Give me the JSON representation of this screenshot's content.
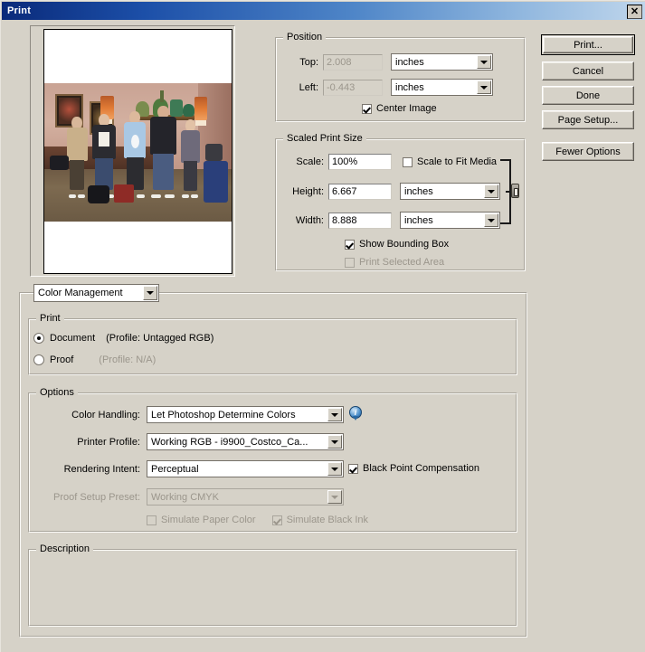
{
  "window": {
    "title": "Print",
    "close_label": "✕"
  },
  "buttons": [
    {
      "name": "print-button",
      "label": "Print...",
      "default": true
    },
    {
      "name": "cancel-button",
      "label": "Cancel",
      "default": false
    },
    {
      "name": "done-button",
      "label": "Done",
      "default": false
    },
    {
      "name": "page-setup-button",
      "label": "Page Setup...",
      "default": false
    },
    {
      "name": "fewer-options-button",
      "label": "Fewer Options",
      "default": false
    }
  ],
  "position": {
    "group_title": "Position",
    "top_label": "Top:",
    "top_value": "2.008",
    "top_units": "inches",
    "left_label": "Left:",
    "left_value": "-0.443",
    "left_units": "inches",
    "center_image_label": "Center Image",
    "center_image_checked": true
  },
  "scaled_print_size": {
    "group_title": "Scaled Print Size",
    "scale_label": "Scale:",
    "scale_value": "100%",
    "scale_to_fit_label": "Scale to Fit Media",
    "scale_to_fit_checked": false,
    "height_label": "Height:",
    "height_value": "6.667",
    "height_units": "inches",
    "width_label": "Width:",
    "width_value": "8.888",
    "width_units": "inches",
    "show_bounding_box_label": "Show Bounding Box",
    "show_bounding_box_checked": true,
    "print_selected_area_label": "Print Selected Area",
    "print_selected_area_checked": false,
    "print_selected_area_enabled": false,
    "link_icon": "chain-link-icon"
  },
  "section_selector": {
    "value": "Color Management"
  },
  "print_group": {
    "group_title": "Print",
    "document_label": "Document",
    "document_profile": "(Profile: Untagged RGB)",
    "document_selected": true,
    "proof_label": "Proof",
    "proof_profile": "(Profile: N/A)",
    "proof_selected": false
  },
  "options": {
    "group_title": "Options",
    "color_handling_label": "Color Handling:",
    "color_handling_value": "Let Photoshop Determine Colors",
    "info_icon": "info-icon",
    "printer_profile_label": "Printer Profile:",
    "printer_profile_value": "Working RGB - i9900_Costco_Ca...",
    "rendering_intent_label": "Rendering Intent:",
    "rendering_intent_value": "Perceptual",
    "black_point_label": "Black Point Compensation",
    "black_point_checked": true,
    "proof_setup_label": "Proof Setup Preset:",
    "proof_setup_value": "Working CMYK",
    "proof_setup_enabled": false,
    "simulate_paper_label": "Simulate Paper Color",
    "simulate_paper_checked": false,
    "simulate_black_label": "Simulate Black Ink",
    "simulate_black_checked": true
  },
  "description": {
    "group_title": "Description",
    "text": ""
  },
  "colors": {
    "dialog_background": "#d6d2c8",
    "titlebar_start": "#0a2a7a",
    "titlebar_end": "#bfd6ec",
    "field_background": "#ffffff",
    "disabled_text": "#9b968c"
  }
}
